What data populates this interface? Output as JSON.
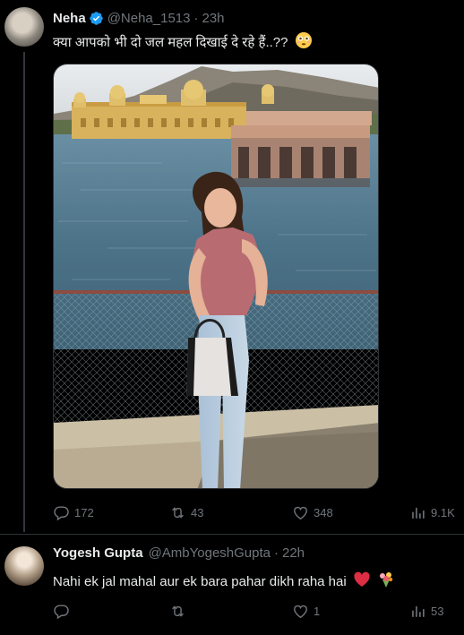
{
  "tweet": {
    "name": "Neha",
    "handle": "@Neha_1513",
    "separator": "·",
    "time": "23h",
    "text": "क्या आपको भी दो जल महल दिखाई दे रहे हैं..??",
    "emoji_icon": "flushed-face-icon",
    "stats": {
      "replies": "172",
      "reposts": "43",
      "likes": "348",
      "views": "9.1K"
    }
  },
  "reply": {
    "name": "Yogesh Gupta",
    "handle": "@AmbYogeshGupta",
    "separator": "·",
    "time": "22h",
    "text": "Nahi ek jal mahal aur ek bara pahar dikh raha hai",
    "emoji_icons": [
      "red-heart-icon",
      "bouquet-icon"
    ],
    "stats": {
      "replies": "",
      "reposts": "",
      "likes": "1",
      "views": "53"
    }
  },
  "colors": {
    "background": "#000000",
    "text_primary": "#e7e9ea",
    "text_secondary": "#71767b",
    "verified_blue": "#1d9bf0",
    "divider": "#2f3336"
  }
}
